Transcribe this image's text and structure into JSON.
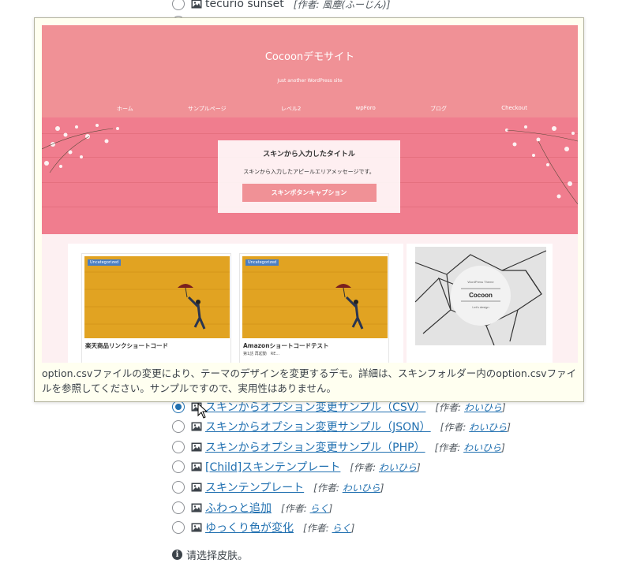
{
  "skin_list_top": {
    "name": "tecurio sunset",
    "author_prefix": "[作者:",
    "author": "風塵(ふーじん)",
    "author_suffix": "]"
  },
  "tooltip": {
    "description": "option.csvファイルの変更により、テーマのデザインを変更するデモ。詳細は、スキンフォルダー内のoption.csvファイルを参照してください。サンプルですので、実用性はありません。",
    "preview": {
      "site_title": "Cocoonデモサイト",
      "tagline": "Just another WordPress site",
      "nav": [
        "ホーム",
        "サンプルページ",
        "レベル2",
        "wpForo",
        "ブログ",
        "Checkout"
      ],
      "hero_title": "スキンから入力したタイトル",
      "hero_message": "スキンから入力したアピールエリアメッセージです。",
      "hero_button": "スキンボタンキャプション",
      "cards": [
        {
          "category": "Uncategorized",
          "title": "楽天商品リンクショートコード",
          "sub": ""
        },
        {
          "category": "Uncategorized",
          "title": "Amazonショートコードテスト",
          "sub": "第1話 再起動　RE..."
        }
      ],
      "sidebar_logo_small": "WordPress Theme",
      "sidebar_logo": "Cocoon",
      "sidebar_logo_tag": "Let's design"
    }
  },
  "skins": [
    {
      "name": "スキンからオプション変更サンプル（CSV）",
      "author": "わいひら",
      "checked": true
    },
    {
      "name": "スキンからオプション変更サンプル（JSON）",
      "author": "わいひら",
      "checked": false
    },
    {
      "name": "スキンからオプション変更サンプル（PHP）",
      "author": "わいひら",
      "checked": false
    },
    {
      "name": "[Child]スキンテンプレート",
      "author": "わいひら",
      "checked": false
    },
    {
      "name": "スキンテンプレート",
      "author": "わいひら",
      "checked": false
    },
    {
      "name": "ふわっと追加",
      "author": "らく",
      "checked": false
    },
    {
      "name": "ゆっくり色が変化",
      "author": "らく",
      "checked": false
    }
  ],
  "author_label": "作者:",
  "note": "请选择皮肤。",
  "colors": {
    "link": "#2271b1",
    "accent_pink": "#f09196",
    "tooltip_bg": "#fffff0"
  }
}
